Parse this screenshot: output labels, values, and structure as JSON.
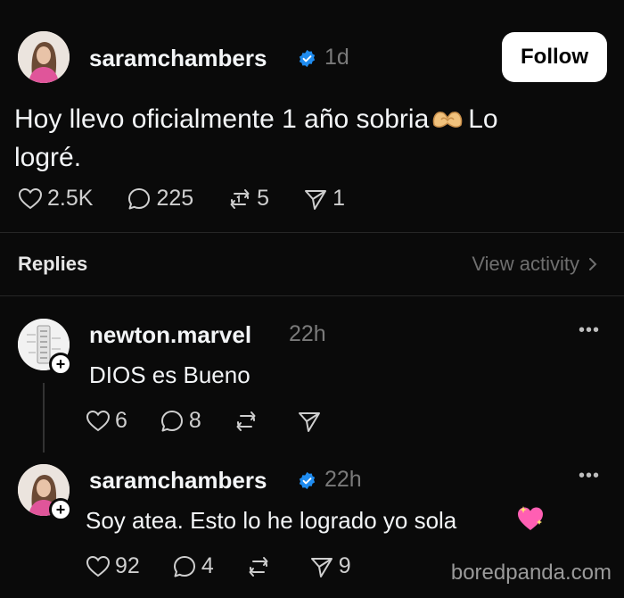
{
  "post": {
    "username": "saramchambers",
    "time": "1d",
    "follow_label": "Follow",
    "text_line1": "Hoy llevo oficialmente 1 año sobria",
    "text_after_emoji": "Lo",
    "text_line2": "logré.",
    "likes": "2.5K",
    "comments": "225",
    "reposts": "5",
    "shares": "1"
  },
  "replies_header": {
    "label": "Replies",
    "view_activity": "View activity"
  },
  "replies": [
    {
      "username": "newton.marvel",
      "time": "22h",
      "text": "DIOS es Bueno",
      "likes": "6",
      "comments": "8"
    },
    {
      "username": "saramchambers",
      "time": "22h",
      "text": "Soy atea. Esto lo he logrado yo sola",
      "likes": "92",
      "comments": "4",
      "shares": "9"
    }
  ],
  "watermark": "boredpanda.com",
  "colors": {
    "background": "#0a0a0a",
    "verified": "#1f8cf0",
    "muted": "#7a7a7a",
    "heart_emoji": "#ff5fb3"
  },
  "icons": [
    "heart-icon",
    "comment-icon",
    "repost-icon",
    "share-icon",
    "verified-badge-icon",
    "chevron-right-icon",
    "more-icon",
    "plus-icon",
    "heart-hands-emoji",
    "sparkling-heart-emoji"
  ]
}
